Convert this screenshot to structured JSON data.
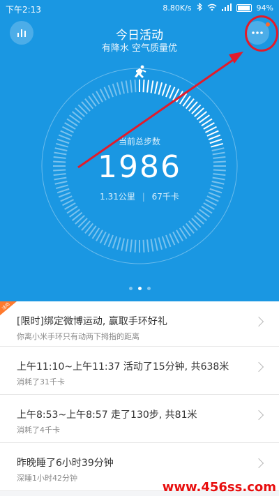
{
  "status_bar": {
    "time": "下午2:13",
    "network_speed": "8.80K/s",
    "battery": "94%"
  },
  "header": {
    "title": "今日活动",
    "subtitle": "有降水 空气质量优"
  },
  "activity": {
    "steps_label": "当前总步数",
    "steps_value": "1986",
    "distance": "1.31公里",
    "calories": "67千卡",
    "progress_fraction": 0.22
  },
  "pager": {
    "count": 3,
    "active_index": 1
  },
  "feed": [
    {
      "title": "[限时]绑定微博运动, 赢取手环好礼",
      "subtitle": "你离小米手环只有动两下拇指的距离",
      "badge": "活动"
    },
    {
      "title": "上午11:10~上午11:37 活动了15分钟, 共638米",
      "subtitle": "消耗了31千卡"
    },
    {
      "title": "上午8:53~上午8:57 走了130步, 共81米",
      "subtitle": "消耗了4千卡"
    },
    {
      "title": "昨晚睡了6小时39分钟",
      "subtitle": "深睡1小时42分钟"
    }
  ],
  "watermark": "www.456ss.com",
  "colors": {
    "hero_bg": "#1a97e2",
    "annotation": "#e21b2b",
    "badge": "#ff7a2d"
  },
  "icons": {
    "stats": "bar-chart-icon",
    "more": "more-dots-icon",
    "activity": "running-person-icon",
    "chevron": "chevron-right-icon"
  }
}
